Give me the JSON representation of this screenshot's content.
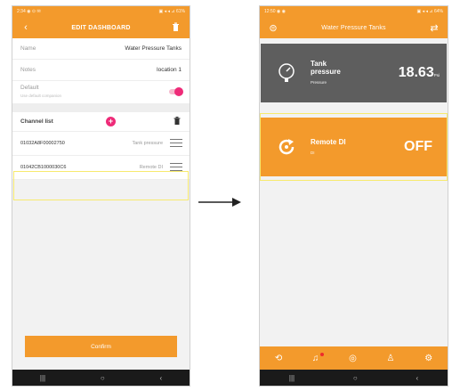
{
  "left": {
    "status": {
      "time": "2:34 ◉ ⊙ ✉",
      "right": "▣ ◂ ◂ ⊿ 61%"
    },
    "appbar": {
      "title": "EDIT DASHBOARD",
      "back": "‹",
      "delete": "🗑"
    },
    "fields": [
      {
        "label": "Name",
        "value": "Water Pressure Tanks"
      },
      {
        "label": "Notes",
        "value": "location 1"
      }
    ],
    "default": {
      "label": "Default",
      "sub": "Use default companion"
    },
    "channels": {
      "title": "Channel list",
      "rows": [
        {
          "id": "01032A8F00002750",
          "name": "Tank pressure"
        },
        {
          "id": "01042CB1000030C6",
          "name": "Remote DI"
        }
      ]
    },
    "confirm": "Confirm",
    "nav": [
      "|||",
      "○",
      "‹"
    ]
  },
  "right": {
    "status": {
      "time": "12:50 ◉ ◉",
      "right": "▣ ◂ ◂ ⊿ 64%"
    },
    "appbar": {
      "title": "Water Pressure Tanks",
      "left_icon": "⊜",
      "right_icon": "⇄"
    },
    "tiles": [
      {
        "name": "Tank pressure",
        "sub": "Pressure",
        "value": "18.63",
        "unit": "Psi",
        "color": "#5e5e5e",
        "icon": "gauge-icon"
      },
      {
        "name": "Remote DI",
        "sub": "DI",
        "value": "OFF",
        "unit": "",
        "color": "#f39a2c",
        "icon": "power-cycle-icon"
      }
    ],
    "bottomnav": [
      "⟲",
      "♫",
      "◎",
      "♙",
      "⚙"
    ],
    "nav": [
      "|||",
      "○",
      "‹"
    ]
  },
  "colors": {
    "accent": "#f39a2c",
    "pink": "#ee2b78",
    "highlight": "#f7ea6e",
    "dark_tile": "#5e5e5e"
  }
}
